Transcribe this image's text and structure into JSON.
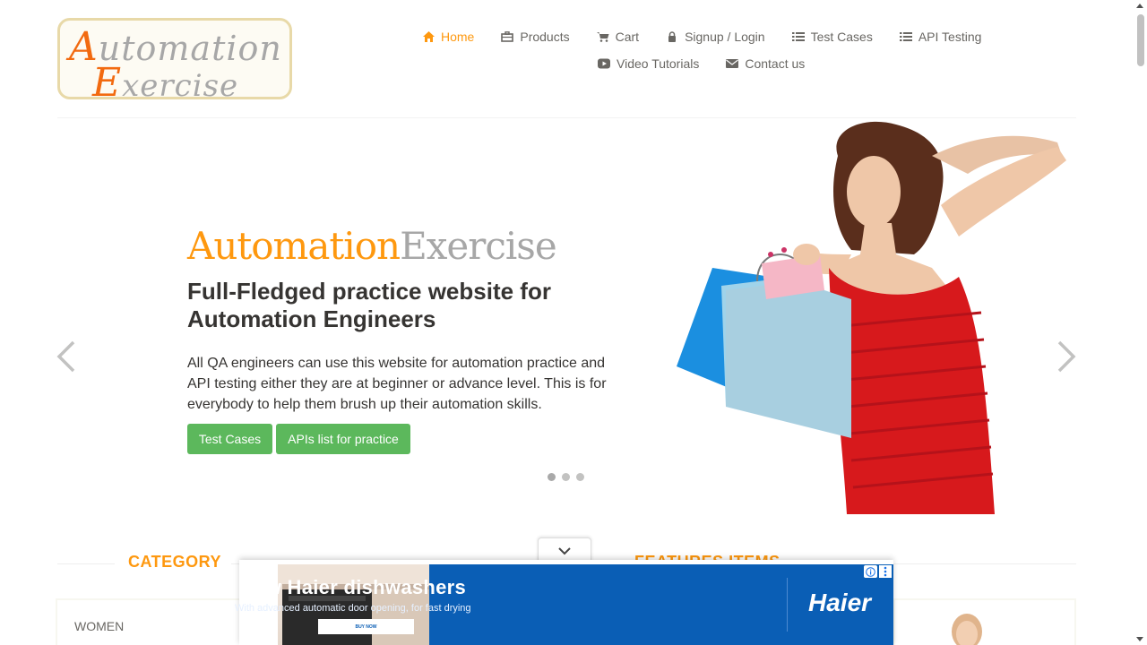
{
  "logo": {
    "line1_cap": "A",
    "line1_rest": "utomation",
    "line2_cap": "E",
    "line2_rest": "xercise"
  },
  "nav": {
    "items": [
      {
        "label": "Home",
        "icon": "home-icon",
        "active": true
      },
      {
        "label": "Products",
        "icon": "briefcase-icon"
      },
      {
        "label": "Cart",
        "icon": "cart-icon"
      },
      {
        "label": "Signup / Login",
        "icon": "lock-icon"
      },
      {
        "label": "Test Cases",
        "icon": "list-icon"
      },
      {
        "label": "API Testing",
        "icon": "list-icon"
      },
      {
        "label": "Video Tutorials",
        "icon": "youtube-icon"
      },
      {
        "label": "Contact us",
        "icon": "envelope-icon"
      }
    ]
  },
  "hero": {
    "brand_part1": "Automation",
    "brand_part2": "Exercise",
    "headline": "Full-Fledged practice website for Automation Engineers",
    "description": "All QA engineers can use this website for automation practice and API testing either they are at beginner or advance level. This is for everybody to help them brush up their automation skills.",
    "buttons": {
      "test_cases": "Test Cases",
      "apis_list": "APIs list for practice"
    },
    "slides": 3,
    "active_slide": 0
  },
  "sidebar": {
    "title": "CATEGORY",
    "items": [
      "WOMEN"
    ]
  },
  "features": {
    "title": "FEATURES ITEMS"
  },
  "ad": {
    "headline": "New Haier dishwashers",
    "subline": "With advanced automatic door opening, for fast drying",
    "cta": "BUY NOW",
    "brand": "Haier"
  },
  "colors": {
    "accent": "#fe980f",
    "button_green": "#5cb85c",
    "ad_blue": "#0a5eb5"
  }
}
